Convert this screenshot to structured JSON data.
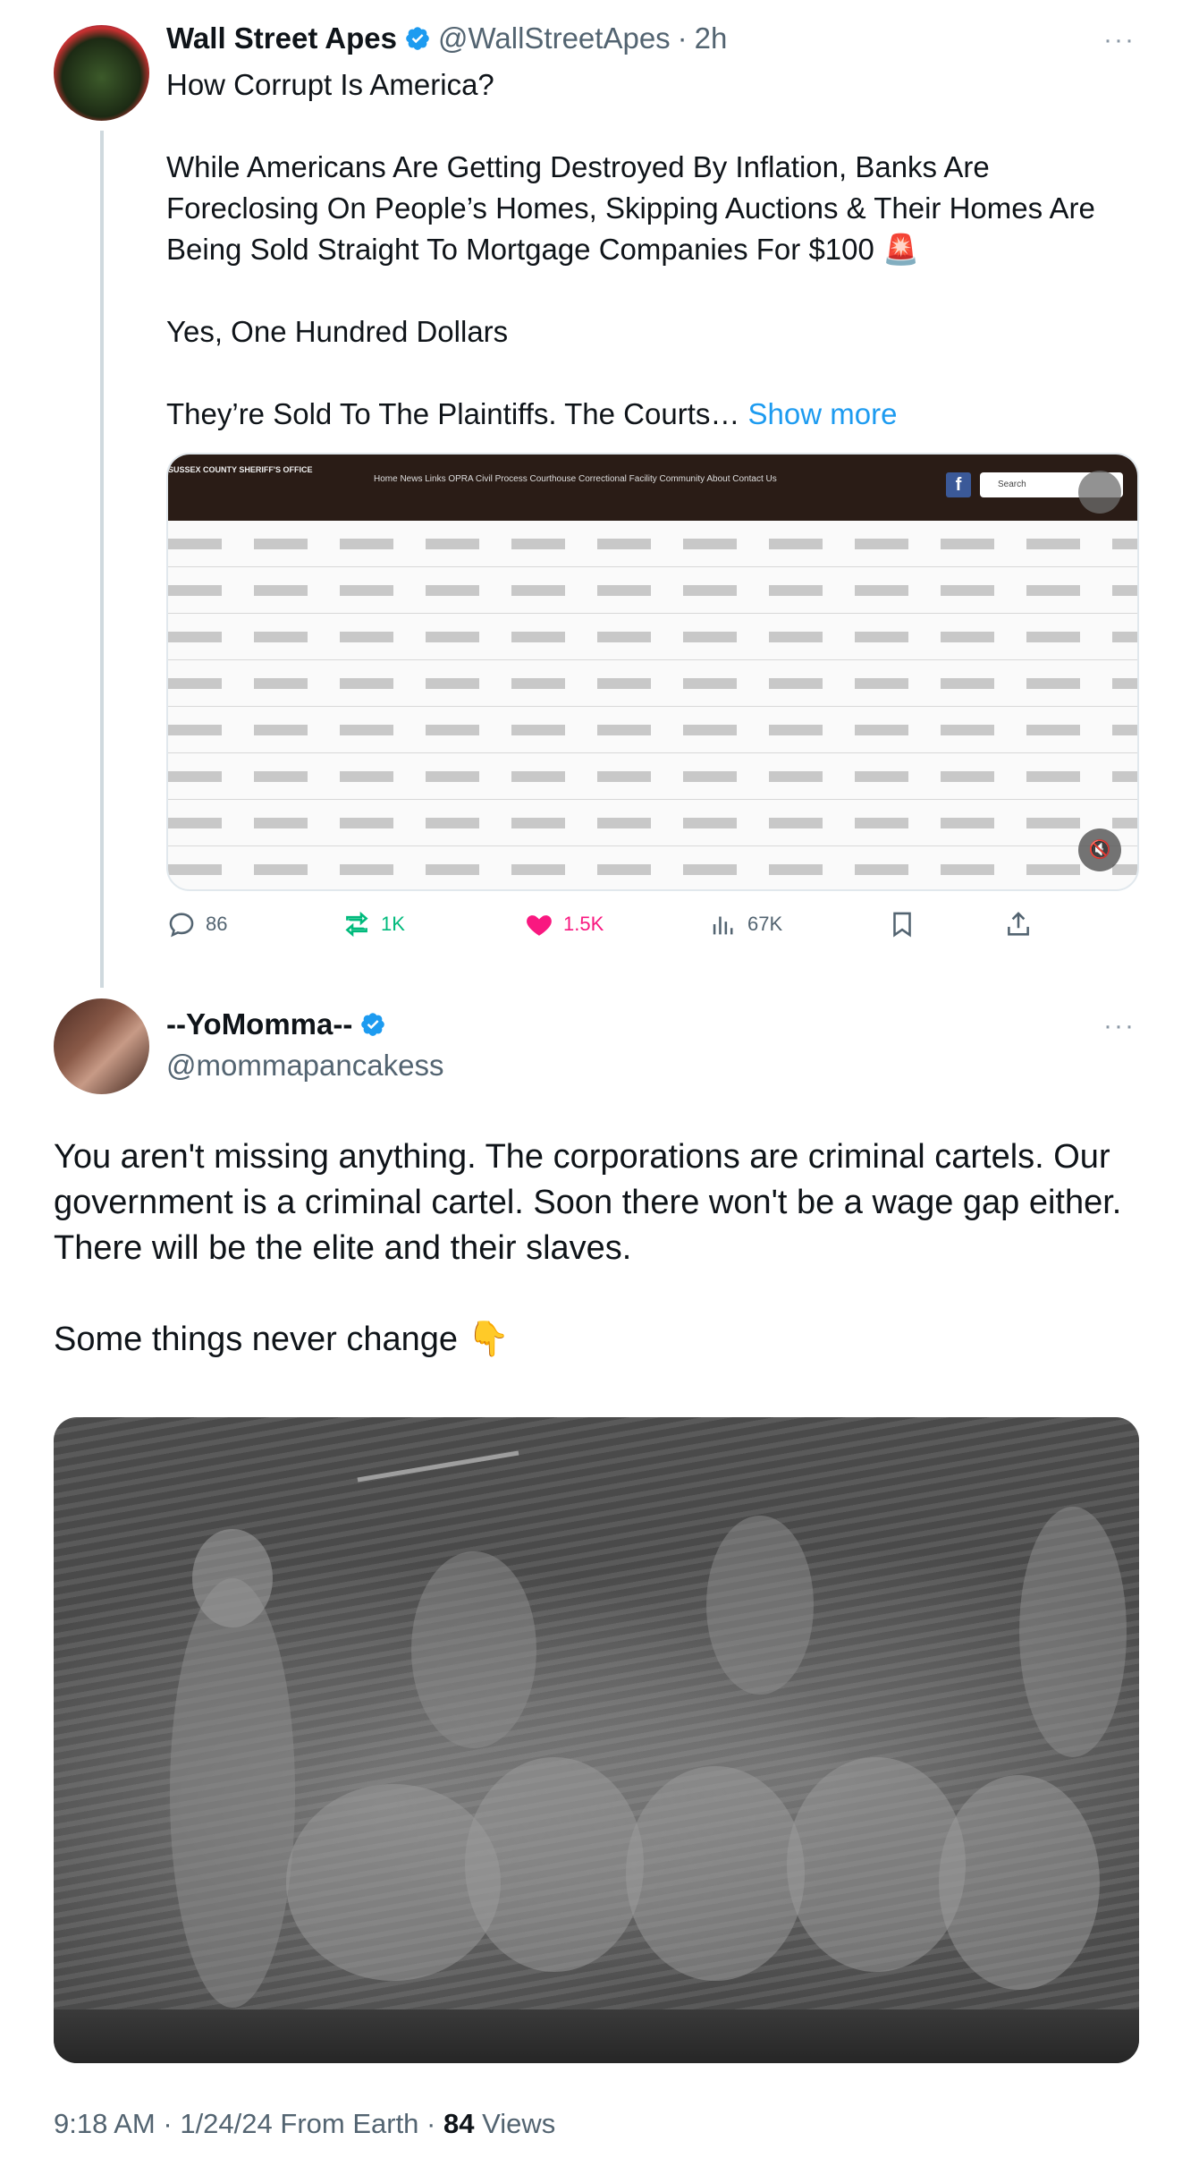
{
  "tweet": {
    "author_name": "Wall Street Apes",
    "handle": "@WallStreetApes",
    "separator": "·",
    "time": "2h",
    "more": "···",
    "lines": [
      "How Corrupt Is America?",
      "While Americans Are Getting Destroyed By Inflation, Banks Are",
      "Foreclosing On People’s Homes, Skipping Auctions & Their Homes Are",
      "Being Sold Straight To Mortgage Companies For $100 🚨",
      "Yes, One Hundred Dollars",
      "They’re Sold To The Plaintiffs. The Courts…"
    ],
    "show_more": "Show more",
    "media_header": "SUSSEX COUNTY SHERIFF'S OFFICE",
    "media_nav": "Home   News   Links   OPRA   Civil Process   Courthouse   Correctional Facility   Community   About   Contact Us",
    "media_fb": "f",
    "media_search": "Search",
    "actions": {
      "replies": "86",
      "retweets": "1K",
      "likes": "1.5K",
      "views": "67K"
    }
  },
  "reply": {
    "author_name": "--YoMomma--",
    "handle": "@mommapancakess",
    "more": "···",
    "lines": [
      "You aren't missing anything. The corporations are criminal cartels. Our",
      "government is a criminal cartel. Soon there won't be a wage gap either.",
      "There will be the elite and their slaves.",
      "Some things never change 👇"
    ]
  },
  "footer": {
    "time": "9:18 AM",
    "sep1": "·",
    "date": "1/24/24",
    "source": "From Earth",
    "sep2": "·",
    "views_count": "84",
    "views_label": "Views"
  },
  "colors": {
    "accent": "#1d9bf0",
    "retweet": "#00ba7c",
    "like": "#f91880",
    "muted": "#536471"
  }
}
